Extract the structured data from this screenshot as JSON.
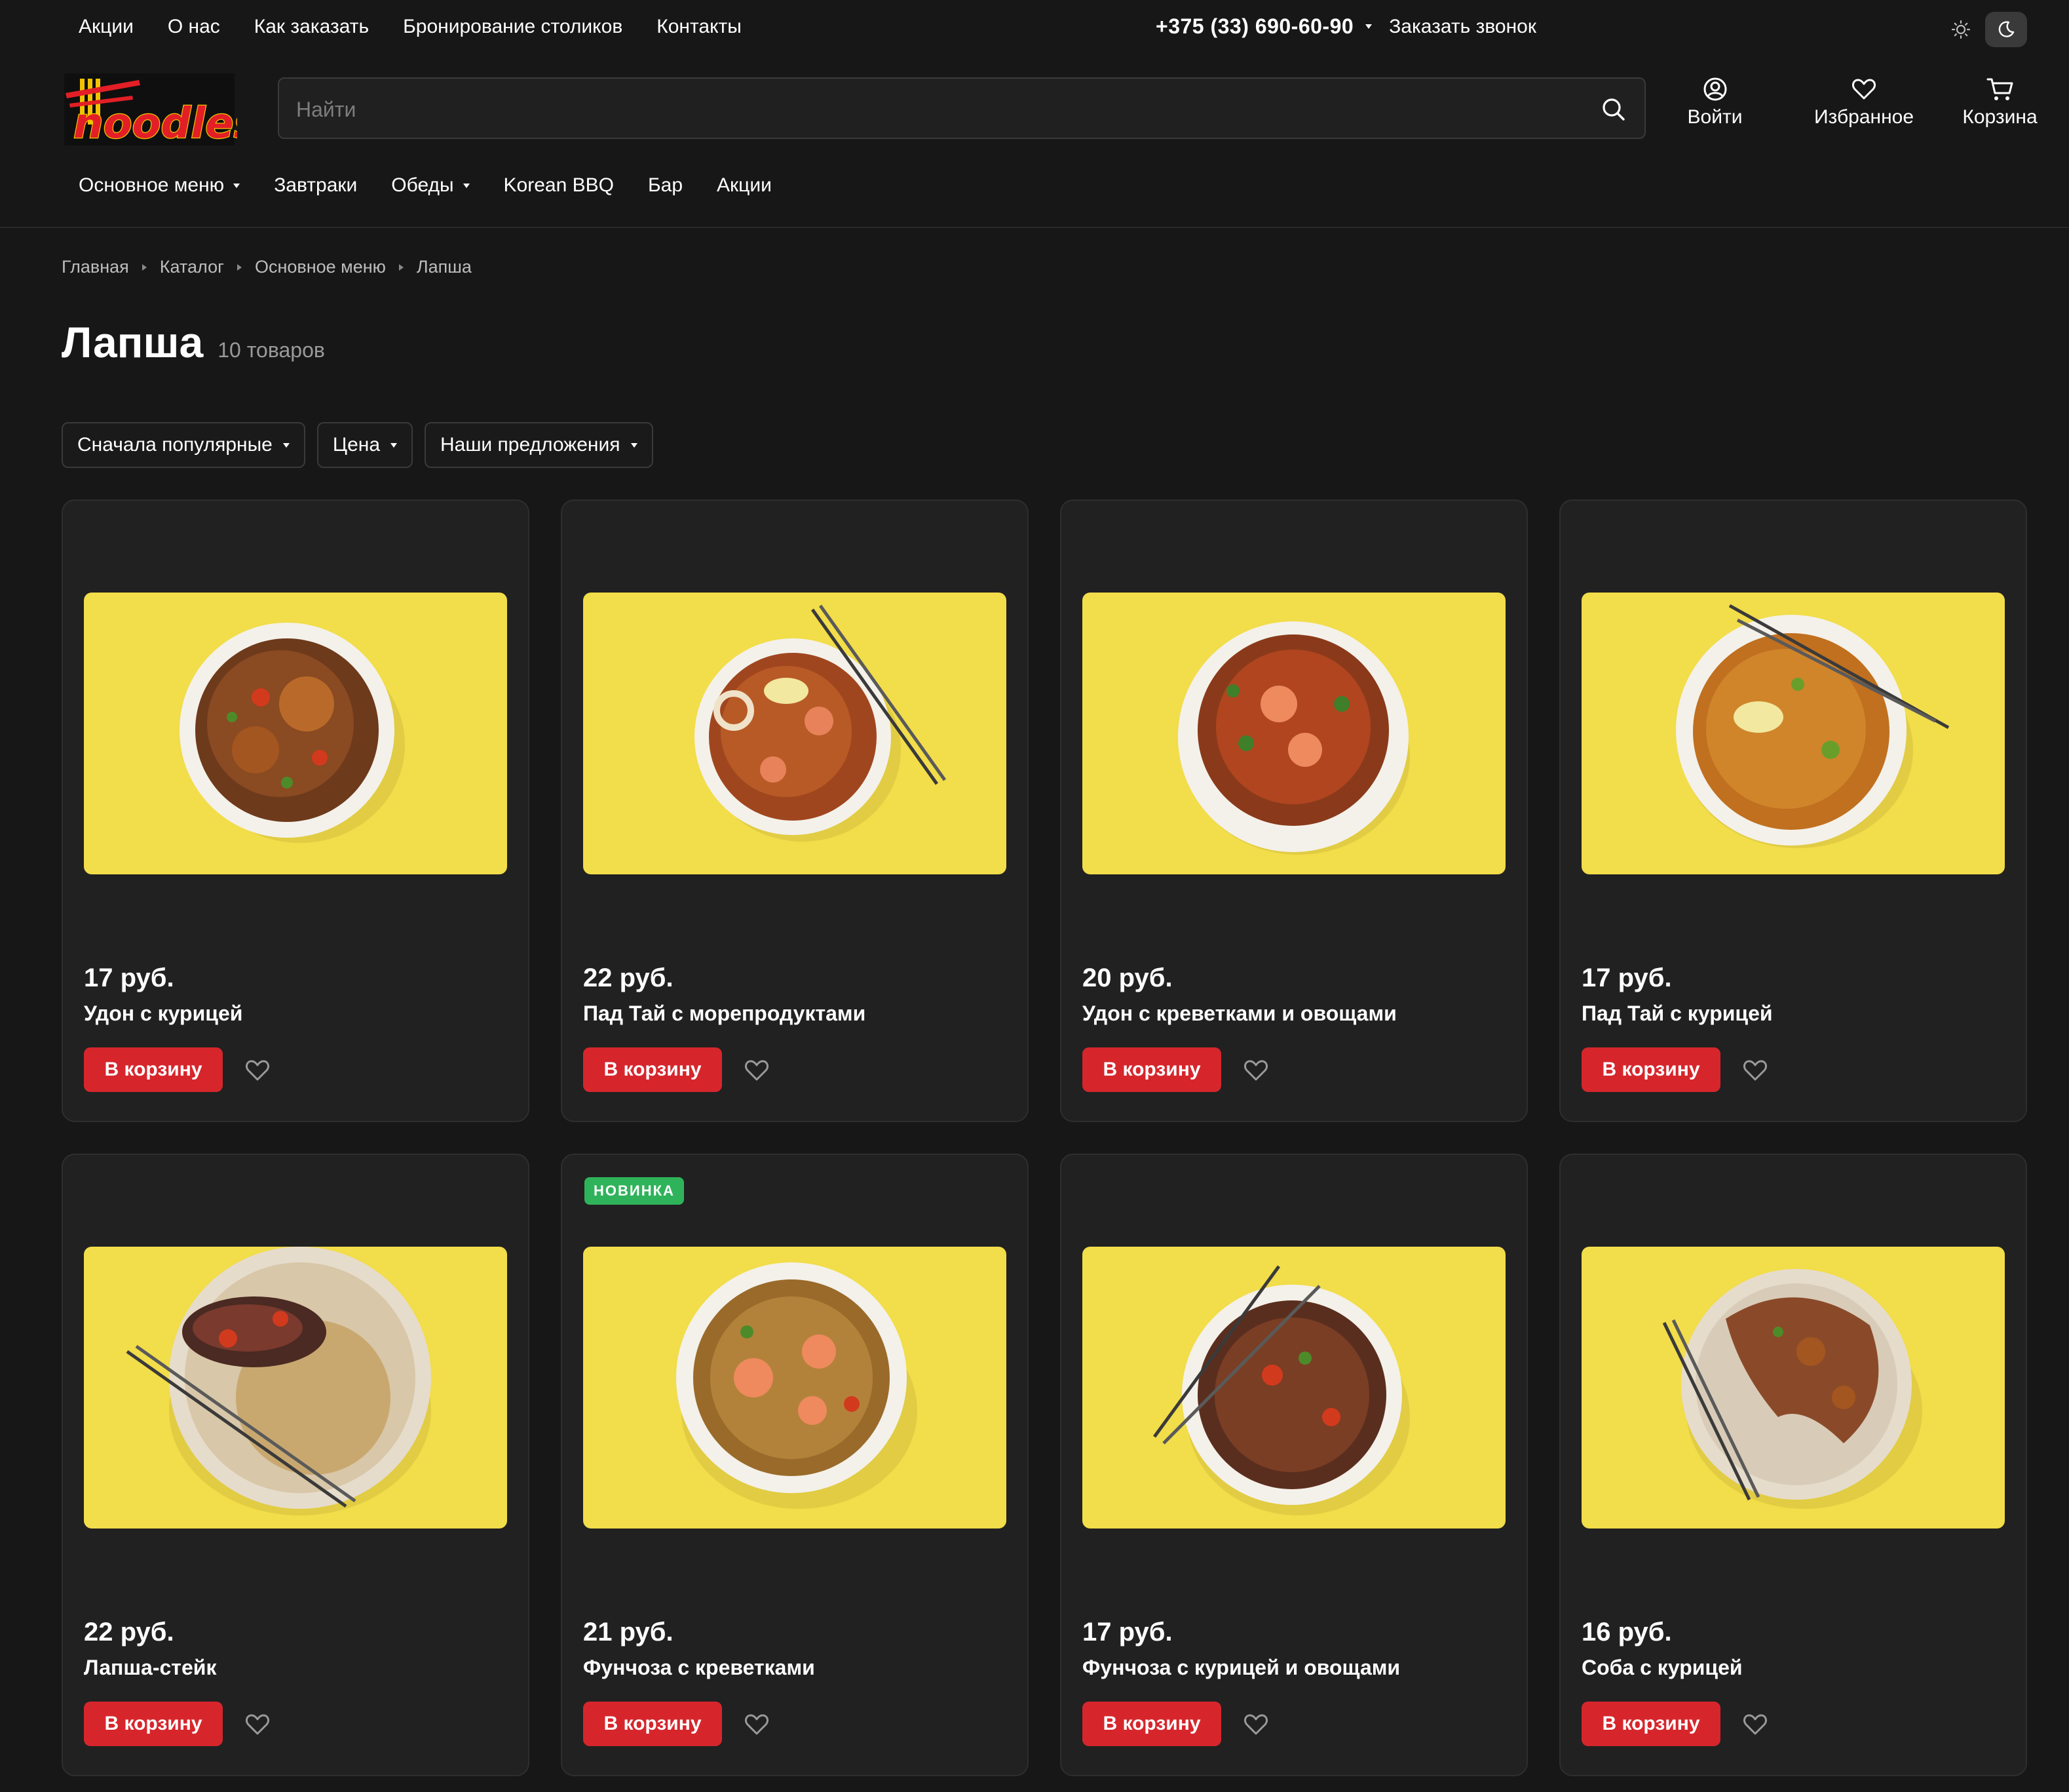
{
  "top_nav": [
    "Акции",
    "О нас",
    "Как заказать",
    "Бронирование столиков",
    "Контакты"
  ],
  "phone": "+375 (33) 690-60-90",
  "callback": "Заказать звонок",
  "logo": {
    "text": "noodles",
    "icon": "chopsticks-logo",
    "colors": {
      "letters": "#e21f26",
      "outline": "#f2c200"
    }
  },
  "search": {
    "placeholder": "Найти",
    "value": ""
  },
  "header_actions": [
    {
      "label": "Войти",
      "icon": "user-icon"
    },
    {
      "label": "Избранное",
      "icon": "heart-icon"
    },
    {
      "label": "Корзина",
      "icon": "cart-icon"
    }
  ],
  "main_menu": [
    {
      "label": "Основное меню",
      "dropdown": true
    },
    {
      "label": "Завтраки",
      "dropdown": false
    },
    {
      "label": "Обеды",
      "dropdown": true
    },
    {
      "label": "Korean BBQ",
      "dropdown": false
    },
    {
      "label": "Бар",
      "dropdown": false
    },
    {
      "label": "Акции",
      "dropdown": false
    }
  ],
  "breadcrumbs": [
    "Главная",
    "Каталог",
    "Основное меню",
    "Лапша"
  ],
  "page": {
    "title": "Лапша",
    "count": "10 товаров"
  },
  "filters": [
    "Сначала популярные",
    "Цена",
    "Наши предложения"
  ],
  "add_to_cart_label": "В корзину",
  "products": [
    {
      "name": "Удон с курицей",
      "price": "17 руб.",
      "badge": ""
    },
    {
      "name": "Пад Тай с морепродуктами",
      "price": "22 руб.",
      "badge": ""
    },
    {
      "name": "Удон с креветками и овощами",
      "price": "20 руб.",
      "badge": ""
    },
    {
      "name": "Пад Тай с курицей",
      "price": "17 руб.",
      "badge": ""
    },
    {
      "name": "Лапша-стейк",
      "price": "22 руб.",
      "badge": ""
    },
    {
      "name": "Фунчоза с креветками",
      "price": "21 руб.",
      "badge": "НОВИНКА"
    },
    {
      "name": "Фунчоза с курицей и овощами",
      "price": "17 руб.",
      "badge": ""
    },
    {
      "name": "Соба с курицей",
      "price": "16 руб.",
      "badge": ""
    }
  ],
  "colors": {
    "background": "#171717",
    "card": "#212121",
    "accent": "#d6262c",
    "badge": "#2fb35a",
    "photo_bg": "#f2dd4a"
  }
}
